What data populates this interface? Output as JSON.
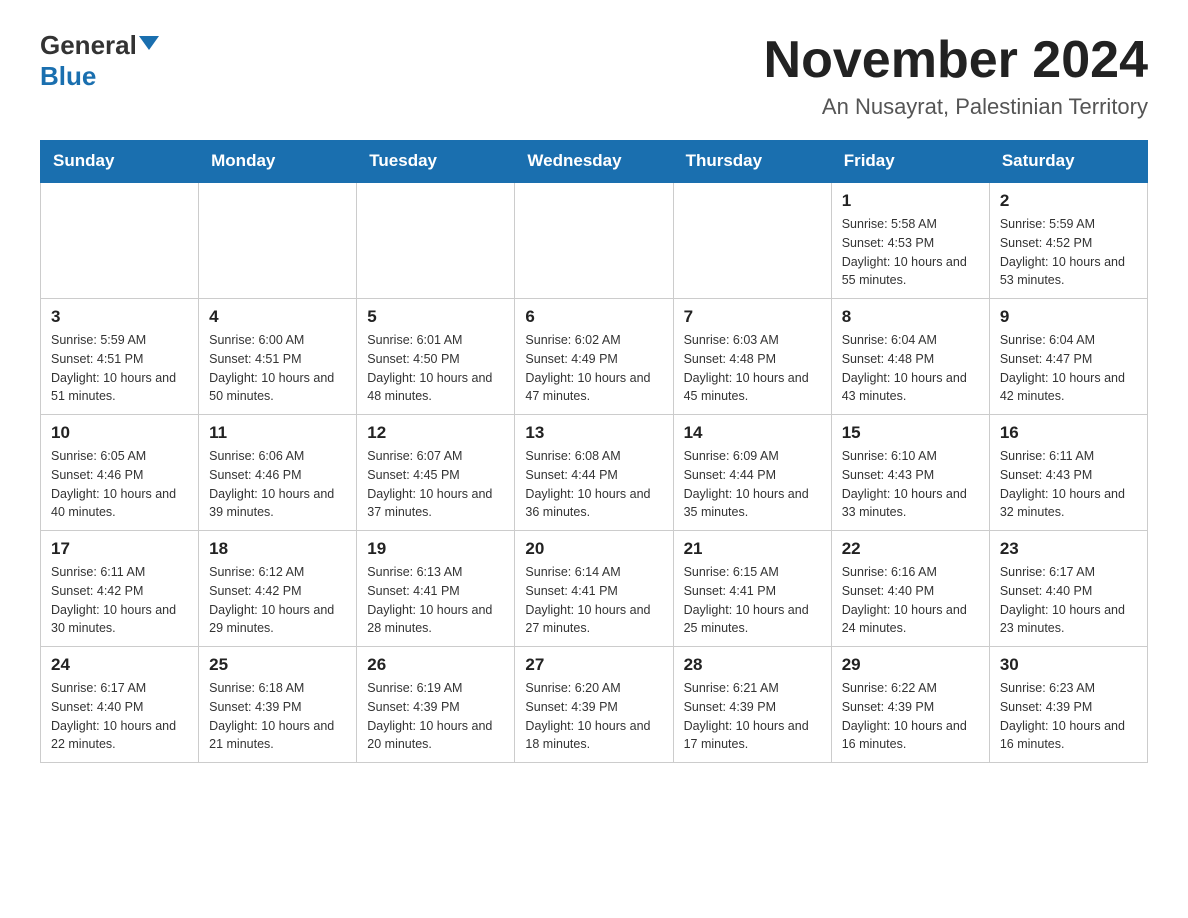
{
  "logo": {
    "general": "General",
    "blue": "Blue"
  },
  "title": "November 2024",
  "location": "An Nusayrat, Palestinian Territory",
  "days_of_week": [
    "Sunday",
    "Monday",
    "Tuesday",
    "Wednesday",
    "Thursday",
    "Friday",
    "Saturday"
  ],
  "weeks": [
    [
      {
        "day": "",
        "info": ""
      },
      {
        "day": "",
        "info": ""
      },
      {
        "day": "",
        "info": ""
      },
      {
        "day": "",
        "info": ""
      },
      {
        "day": "",
        "info": ""
      },
      {
        "day": "1",
        "info": "Sunrise: 5:58 AM\nSunset: 4:53 PM\nDaylight: 10 hours and 55 minutes."
      },
      {
        "day": "2",
        "info": "Sunrise: 5:59 AM\nSunset: 4:52 PM\nDaylight: 10 hours and 53 minutes."
      }
    ],
    [
      {
        "day": "3",
        "info": "Sunrise: 5:59 AM\nSunset: 4:51 PM\nDaylight: 10 hours and 51 minutes."
      },
      {
        "day": "4",
        "info": "Sunrise: 6:00 AM\nSunset: 4:51 PM\nDaylight: 10 hours and 50 minutes."
      },
      {
        "day": "5",
        "info": "Sunrise: 6:01 AM\nSunset: 4:50 PM\nDaylight: 10 hours and 48 minutes."
      },
      {
        "day": "6",
        "info": "Sunrise: 6:02 AM\nSunset: 4:49 PM\nDaylight: 10 hours and 47 minutes."
      },
      {
        "day": "7",
        "info": "Sunrise: 6:03 AM\nSunset: 4:48 PM\nDaylight: 10 hours and 45 minutes."
      },
      {
        "day": "8",
        "info": "Sunrise: 6:04 AM\nSunset: 4:48 PM\nDaylight: 10 hours and 43 minutes."
      },
      {
        "day": "9",
        "info": "Sunrise: 6:04 AM\nSunset: 4:47 PM\nDaylight: 10 hours and 42 minutes."
      }
    ],
    [
      {
        "day": "10",
        "info": "Sunrise: 6:05 AM\nSunset: 4:46 PM\nDaylight: 10 hours and 40 minutes."
      },
      {
        "day": "11",
        "info": "Sunrise: 6:06 AM\nSunset: 4:46 PM\nDaylight: 10 hours and 39 minutes."
      },
      {
        "day": "12",
        "info": "Sunrise: 6:07 AM\nSunset: 4:45 PM\nDaylight: 10 hours and 37 minutes."
      },
      {
        "day": "13",
        "info": "Sunrise: 6:08 AM\nSunset: 4:44 PM\nDaylight: 10 hours and 36 minutes."
      },
      {
        "day": "14",
        "info": "Sunrise: 6:09 AM\nSunset: 4:44 PM\nDaylight: 10 hours and 35 minutes."
      },
      {
        "day": "15",
        "info": "Sunrise: 6:10 AM\nSunset: 4:43 PM\nDaylight: 10 hours and 33 minutes."
      },
      {
        "day": "16",
        "info": "Sunrise: 6:11 AM\nSunset: 4:43 PM\nDaylight: 10 hours and 32 minutes."
      }
    ],
    [
      {
        "day": "17",
        "info": "Sunrise: 6:11 AM\nSunset: 4:42 PM\nDaylight: 10 hours and 30 minutes."
      },
      {
        "day": "18",
        "info": "Sunrise: 6:12 AM\nSunset: 4:42 PM\nDaylight: 10 hours and 29 minutes."
      },
      {
        "day": "19",
        "info": "Sunrise: 6:13 AM\nSunset: 4:41 PM\nDaylight: 10 hours and 28 minutes."
      },
      {
        "day": "20",
        "info": "Sunrise: 6:14 AM\nSunset: 4:41 PM\nDaylight: 10 hours and 27 minutes."
      },
      {
        "day": "21",
        "info": "Sunrise: 6:15 AM\nSunset: 4:41 PM\nDaylight: 10 hours and 25 minutes."
      },
      {
        "day": "22",
        "info": "Sunrise: 6:16 AM\nSunset: 4:40 PM\nDaylight: 10 hours and 24 minutes."
      },
      {
        "day": "23",
        "info": "Sunrise: 6:17 AM\nSunset: 4:40 PM\nDaylight: 10 hours and 23 minutes."
      }
    ],
    [
      {
        "day": "24",
        "info": "Sunrise: 6:17 AM\nSunset: 4:40 PM\nDaylight: 10 hours and 22 minutes."
      },
      {
        "day": "25",
        "info": "Sunrise: 6:18 AM\nSunset: 4:39 PM\nDaylight: 10 hours and 21 minutes."
      },
      {
        "day": "26",
        "info": "Sunrise: 6:19 AM\nSunset: 4:39 PM\nDaylight: 10 hours and 20 minutes."
      },
      {
        "day": "27",
        "info": "Sunrise: 6:20 AM\nSunset: 4:39 PM\nDaylight: 10 hours and 18 minutes."
      },
      {
        "day": "28",
        "info": "Sunrise: 6:21 AM\nSunset: 4:39 PM\nDaylight: 10 hours and 17 minutes."
      },
      {
        "day": "29",
        "info": "Sunrise: 6:22 AM\nSunset: 4:39 PM\nDaylight: 10 hours and 16 minutes."
      },
      {
        "day": "30",
        "info": "Sunrise: 6:23 AM\nSunset: 4:39 PM\nDaylight: 10 hours and 16 minutes."
      }
    ]
  ]
}
